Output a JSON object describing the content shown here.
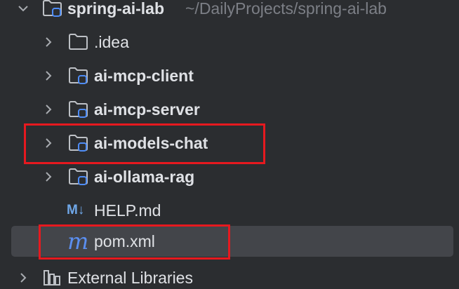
{
  "project": {
    "name": "spring-ai-lab",
    "path": "~/DailyProjects/spring-ai-lab"
  },
  "items": [
    {
      "label": ".idea",
      "type": "folder"
    },
    {
      "label": "ai-mcp-client",
      "type": "module"
    },
    {
      "label": "ai-mcp-server",
      "type": "module"
    },
    {
      "label": "ai-models-chat",
      "type": "module"
    },
    {
      "label": "ai-ollama-rag",
      "type": "module"
    },
    {
      "label": "HELP.md",
      "type": "markdown",
      "icon_text": "M↓"
    },
    {
      "label": "pom.xml",
      "type": "maven",
      "icon_text": "m"
    }
  ],
  "external_libraries": {
    "label": "External Libraries"
  },
  "colors": {
    "background": "#2b2d30",
    "selection": "#43454a",
    "text": "#dfe1e5",
    "muted_text": "#7c7f86",
    "module_badge": "#4e8cf6",
    "highlight_box": "#e6191f"
  }
}
